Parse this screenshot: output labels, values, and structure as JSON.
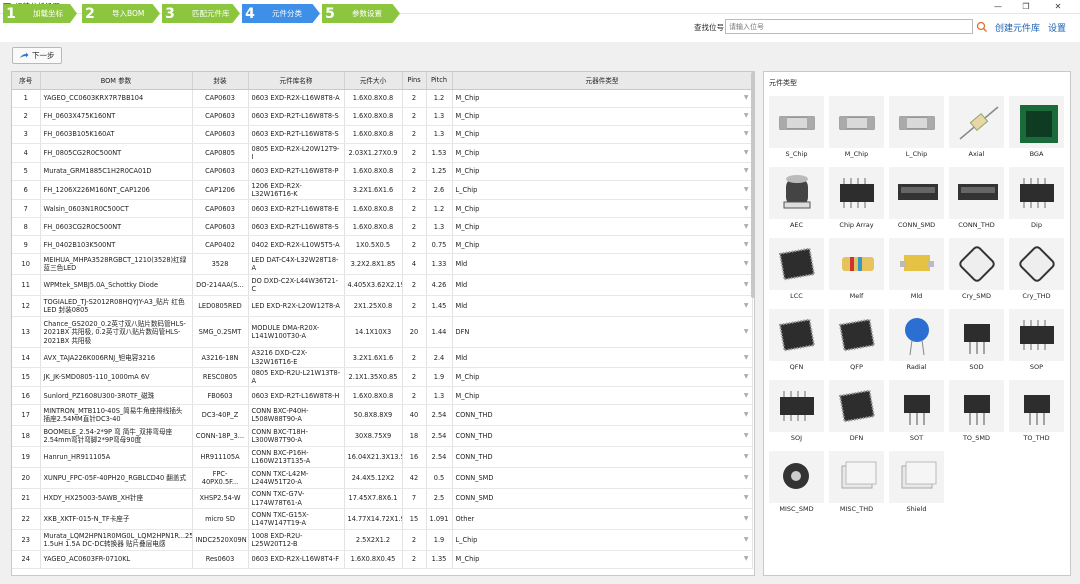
{
  "window": {
    "title": "组装分析设置"
  },
  "steps": [
    {
      "num": "1",
      "label": "加载坐标"
    },
    {
      "num": "2",
      "label": "导入BOM"
    },
    {
      "num": "3",
      "label": "匹配元件库"
    },
    {
      "num": "4",
      "label": "元件分类"
    },
    {
      "num": "5",
      "label": "参数设置"
    }
  ],
  "search": {
    "label": "查找位号",
    "placeholder": "请输入位号"
  },
  "header_actions": {
    "create_lib": "创建元件库",
    "settings": "设置"
  },
  "toolbar": {
    "next": "下一步"
  },
  "table": {
    "columns": [
      "序号",
      "BOM 参数",
      "封装",
      "元件库名称",
      "元件大小",
      "Pins",
      "Pitch",
      "元器件类型"
    ],
    "rows": [
      [
        "1",
        "YAGEO_CC0603KRX7R7BB104",
        "CAP0603",
        "0603 EXD-R2X-L16W8T8-A",
        "1.6X0.8X0.8",
        "2",
        "1.2",
        "M_Chip"
      ],
      [
        "2",
        "FH_0603X475K160NT",
        "CAP0603",
        "0603 EXD-R2T-L16W8T8-S",
        "1.6X0.8X0.8",
        "2",
        "1.3",
        "M_Chip"
      ],
      [
        "3",
        "FH_0603B105K160AT",
        "CAP0603",
        "0603 EXD-R2T-L16W8T8-S",
        "1.6X0.8X0.8",
        "2",
        "1.3",
        "M_Chip"
      ],
      [
        "4",
        "FH_0805CG2R0C500NT",
        "CAP0805",
        "0805 EXD-R2X-L20W12T9-I",
        "2.03X1.27X0.9",
        "2",
        "1.53",
        "M_Chip"
      ],
      [
        "5",
        "Murata_GRM1885C1H2R0CA01D",
        "CAP0603",
        "0603 EXD-R2T-L16W8T8-P",
        "1.6X0.8X0.8",
        "2",
        "1.25",
        "M_Chip"
      ],
      [
        "6",
        "FH_1206X226M160NT_CAP1206",
        "CAP1206",
        "1206 EXD-R2X-L32W16T16-K",
        "3.2X1.6X1.6",
        "2",
        "2.6",
        "L_Chip"
      ],
      [
        "7",
        "Walsin_0603N1R0C500CT",
        "CAP0603",
        "0603 EXD-R2T-L16W8T8-E",
        "1.6X0.8X0.8",
        "2",
        "1.2",
        "M_Chip"
      ],
      [
        "8",
        "FH_0603CG2R0C500NT",
        "CAP0603",
        "0603 EXD-R2T-L16W8T8-S",
        "1.6X0.8X0.8",
        "2",
        "1.3",
        "M_Chip"
      ],
      [
        "9",
        "FH_0402B103K500NT",
        "CAP0402",
        "0402 EXD-R2X-L10W5T5-A",
        "1X0.5X0.5",
        "2",
        "0.75",
        "M_Chip"
      ],
      [
        "10",
        "MEIHUA_MHPA3528RGBCT_1210(3528)红绿蓝三色LED",
        "3528",
        "LED DAT-C4X-L32W28T18-A",
        "3.2X2.8X1.85",
        "4",
        "1.33",
        "Mld"
      ],
      [
        "11",
        "WPMtek_SMBJ5.0A_Schottky Diode",
        "DO-214AA(S...",
        "DO DXD-C2X-L44W36T21-C",
        "4.405X3.62X2.199",
        "2",
        "4.26",
        "Mld"
      ],
      [
        "12",
        "TOGIALED_TJ-S2012R08HQYJY-A3_贴片 红色LED 封装0805",
        "LED0805RED",
        "LED EXD-R2X-L20W12T8-A",
        "2X1.25X0.8",
        "2",
        "1.45",
        "Mld"
      ],
      [
        "13",
        "Chance_GS2020_0.2英寸双八贴片数码管HLS-2021BX 共阳极, 0.2英寸双八贴片数码管HLS-2021BX 共阳极",
        "SMG_0.2SMT",
        "MODULE DMA-R20X-L141W100T30-A",
        "14.1X10X3",
        "20",
        "1.44",
        "DFN"
      ],
      [
        "14",
        "AVX_TAJA226K006RNJ_钽电容3216",
        "A3216-18N",
        "A3216 DXD-C2X-L32W16T16-E",
        "3.2X1.6X1.6",
        "2",
        "2.4",
        "Mld"
      ],
      [
        "15",
        "JK_JK-SMD0805-110_1000mA 6V",
        "RESC0805",
        "0805 EXD-R2U-L21W13T8-A",
        "2.1X1.35X0.85",
        "2",
        "1.9",
        "M_Chip"
      ],
      [
        "16",
        "Sunlord_PZ1608U300-3R0TF_磁珠",
        "FB0603",
        "0603 EXD-R2T-L16W8T8-H",
        "1.6X0.8X0.8",
        "2",
        "1.3",
        "M_Chip"
      ],
      [
        "17",
        "MINTRON_MTB110-40S_简易牛角座排线插头插座2.54MM直针DC3-40",
        "DC3-40P_Z",
        "CONN BXC-P40H-L508W88T90-A",
        "50.8X8.8X9",
        "40",
        "2.54",
        "CONN_THD"
      ],
      [
        "18",
        "BOOMELE_2.54-2*9P 弯 简牛_双排弯母座2.54mm弯针弯脚2*9P弯母90度",
        "CONN-18P_3...",
        "CONN BXC-T18H-L300W87T90-A",
        "30X8.75X9",
        "18",
        "2.54",
        "CONN_THD"
      ],
      [
        "19",
        "Hanrun_HR911105A",
        "HR911105A",
        "CONN BXC-P16H-L160W213T135-A",
        "16.04X21.3X13.5",
        "16",
        "2.54",
        "CONN_THD"
      ],
      [
        "20",
        "XUNPU_FPC-05F-40PH20_RGBLCD40 翻盖式",
        "FPC-40PX0.5F...",
        "CONN TXC-L42M-L244W51T20-A",
        "24.4X5.12X2",
        "42",
        "0.5",
        "CONN_SMD"
      ],
      [
        "21",
        "HXDY_HX25003-5AWB_XH针座",
        "XHSP2.54-W",
        "CONN TXC-G7V-L174W78T61-A",
        "17.45X7.8X6.1",
        "7",
        "2.5",
        "CONN_SMD"
      ],
      [
        "22",
        "XKB_XKTF-015-N_TF卡座子",
        "micro SD",
        "CONN TXC-G15X-L147W147T19-A",
        "14.77X14.72X1.9",
        "15",
        "1.091",
        "Other"
      ],
      [
        "23",
        "Murata_LQM2HPN1R0MG0L_LQM2HPN1R...2520 1.5uH 1.5A DC-DC转换器 贴片叠层电感",
        "INDC2520X09N",
        "1008 EXD-R2U-L25W20T12-B",
        "2.5X2X1.2",
        "2",
        "1.9",
        "L_Chip"
      ],
      [
        "24",
        "YAGEO_AC0603FR-0710KL",
        "Res0603",
        "0603 EXD-R2X-L16W8T4-F",
        "1.6X0.8X0.45",
        "2",
        "1.35",
        "M_Chip"
      ]
    ]
  },
  "panel": {
    "title": "元件类型",
    "types": [
      "S_Chip",
      "M_Chip",
      "L_Chip",
      "Axial",
      "BGA",
      "AEC",
      "Chip Array",
      "CONN_SMD",
      "CONN_THD",
      "Dip",
      "LCC",
      "Melf",
      "Mld",
      "Cry_SMD",
      "Cry_THD",
      "QFN",
      "QFP",
      "Radial",
      "SOD",
      "SOP",
      "SOJ",
      "DFN",
      "SOT",
      "TO_SMD",
      "TO_THD",
      "MISC_SMD",
      "MISC_THD",
      "Shield"
    ]
  },
  "colors": {
    "step_active": "#3d8fe8",
    "step_done": "#8cc63f",
    "link": "#1a5fb4"
  }
}
